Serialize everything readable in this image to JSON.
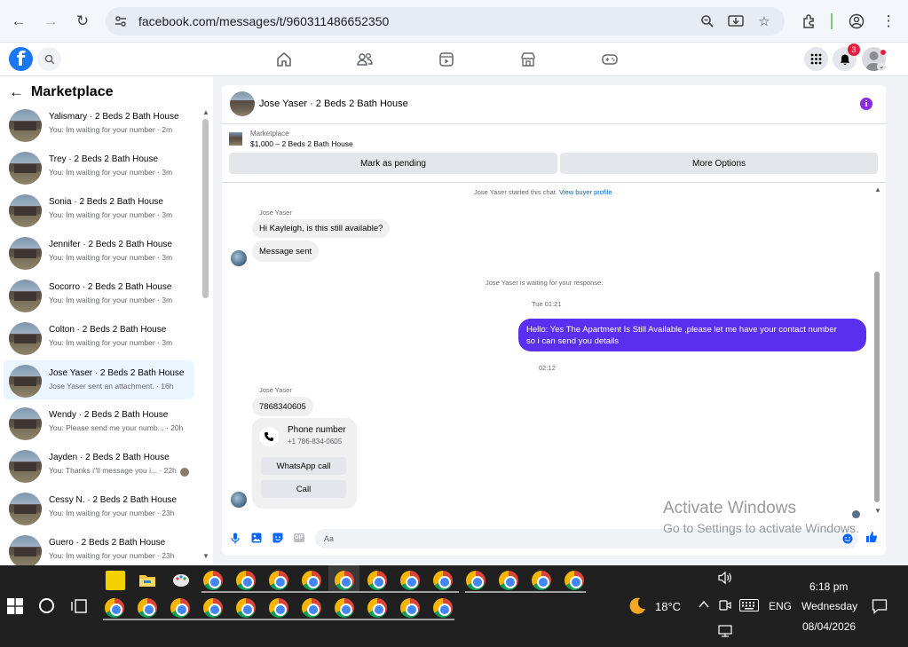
{
  "browser": {
    "url": "facebook.com/messages/t/960311486652350"
  },
  "fb": {
    "notification_count": "3"
  },
  "left": {
    "title": "Marketplace",
    "conversations": [
      {
        "title": "Yalismary · 2 Beds 2 Bath House",
        "sub": "You: Im waiting for your number · 2m"
      },
      {
        "title": "Trey · 2 Beds 2 Bath House",
        "sub": "You: Im waiting for your number · 3m"
      },
      {
        "title": "Sonia · 2 Beds 2 Bath House",
        "sub": "You: Im waiting for your number · 3m"
      },
      {
        "title": "Jennifer · 2 Beds 2 Bath House",
        "sub": "You: Im waiting for your number · 3m"
      },
      {
        "title": "Socorro · 2 Beds 2 Bath House",
        "sub": "You: Im waiting for your number · 3m"
      },
      {
        "title": "Colton · 2 Beds 2 Bath House",
        "sub": "You: Im waiting for your number · 3m"
      },
      {
        "title": "Jose Yaser · 2 Beds 2 Bath House",
        "sub": "Jose Yaser sent an attachment. · 16h"
      },
      {
        "title": "Wendy · 2 Beds 2 Bath House",
        "sub": "You: Please send me your numb... · 20h"
      },
      {
        "title": "Jayden · 2 Beds 2 Bath House",
        "sub": "You: Thanks i\"ll message you i... · 22h"
      },
      {
        "title": "Cessy N. · 2 Beds 2 Bath House",
        "sub": "You: Im waiting for your number · 23h"
      },
      {
        "title": "Guero · 2 Beds 2 Bath House",
        "sub": "You: Im waiting for your number · 23h"
      }
    ]
  },
  "chat": {
    "header_name": "Jose Yaser · 2 Beds 2 Bath House",
    "listing_label": "Marketplace",
    "listing_price": "$1,000 – 2 Beds 2 Bath House",
    "mark_pending": "Mark as pending",
    "more_options": "More Options",
    "started_text": "Jose Yaser started this chat.",
    "view_profile": "View buyer profile",
    "sender1": "Jose Yaser",
    "msg1": "Hi Kayleigh, is this still available?",
    "msg2": "Message sent",
    "waiting_text": "Jose Yaser is waiting for your response.",
    "time1": "Tue 01:21",
    "out_line1": "Hello: Yes The Apartment Is Still Available ,please let me have your contact number",
    "out_line2": "so i can send you details",
    "time2": "02:12",
    "sender2": "Jose Yaser",
    "msg3": "7868340605",
    "card_title": "Phone number",
    "card_number": "+1 786-834-0605",
    "whatsapp": "WhatsApp call",
    "call": "Call",
    "composer_placeholder": "Aa"
  },
  "watermark": {
    "line1": "Activate Windows",
    "line2": "Go to Settings to activate Windows."
  },
  "taskbar": {
    "weather": "18°C",
    "lang": "ENG",
    "time": "6:18 pm",
    "day": "Wednesday",
    "date": "08/04/2026"
  }
}
